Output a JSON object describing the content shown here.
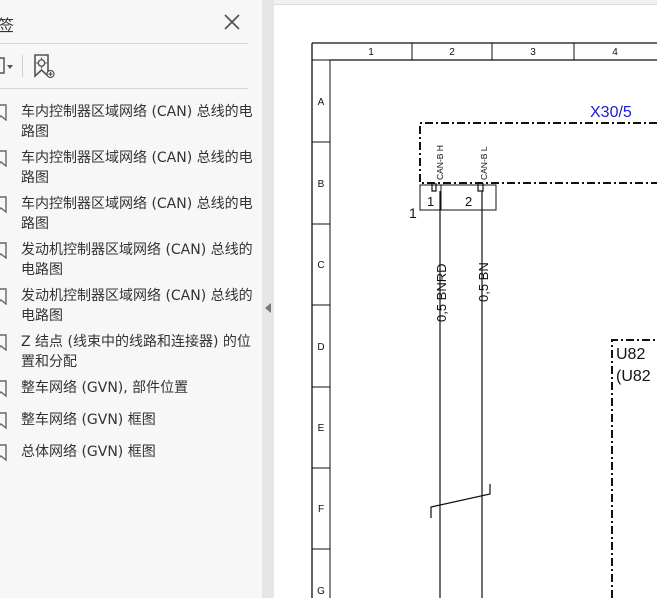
{
  "panel": {
    "title": "签",
    "bookmarks": [
      {
        "label": "车内控制器区域网络 (CAN) 总线的电路图"
      },
      {
        "label": "车内控制器区域网络 (CAN) 总线的电路图"
      },
      {
        "label": "车内控制器区域网络 (CAN) 总线的电路图"
      },
      {
        "label": "发动机控制器区域网络 (CAN) 总线的电路图"
      },
      {
        "label": "发动机控制器区域网络 (CAN) 总线的电路图"
      },
      {
        "label": "Z 结点 (线束中的线路和连接器) 的位置和分配"
      },
      {
        "label": "整车网络 (GVN), 部件位置"
      },
      {
        "label": "整车网络 (GVN) 框图"
      },
      {
        "label": "总体网络 (GVN) 框图"
      }
    ]
  },
  "diagram": {
    "col_labels": [
      "1",
      "2",
      "3",
      "4"
    ],
    "row_labels": [
      "A",
      "B",
      "C",
      "D",
      "E",
      "F",
      "G"
    ],
    "connector_id": "X30/5",
    "pin_labels": [
      "CAN-B H",
      "CAN-B L"
    ],
    "pin_numbers": [
      "1",
      "2"
    ],
    "side_number": "1",
    "wire_labels": [
      "0,5 BNRD",
      "0,5 BN"
    ],
    "component_code": "U82",
    "component_code_paren": "(U82",
    "colors": {
      "connector_id": "#1a1ad6",
      "line": "#111111"
    }
  }
}
